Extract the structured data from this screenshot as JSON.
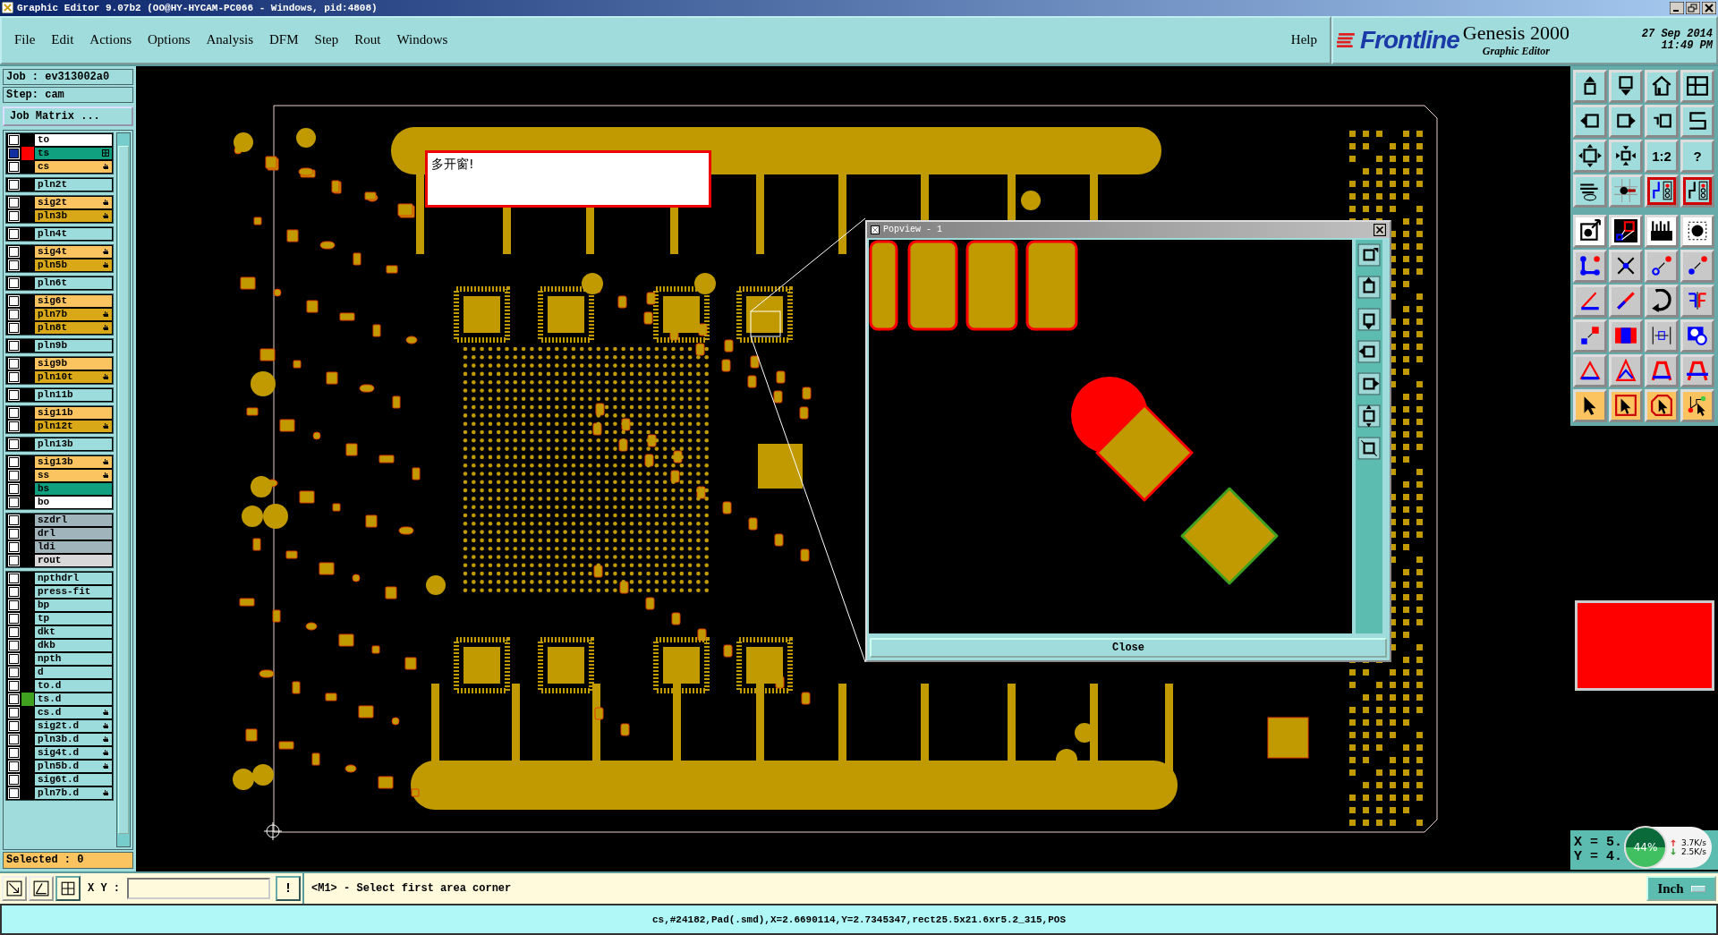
{
  "window": {
    "title": "Graphic Editor 9.07b2 (OO@HY-HYCAM-PC066 - Windows, pid:4808)"
  },
  "menu": [
    "File",
    "Edit",
    "Actions",
    "Options",
    "Analysis",
    "DFM",
    "Step",
    "Rout",
    "Windows"
  ],
  "help": "Help",
  "brand": {
    "logo": "Frontline",
    "product": "Genesis 2000",
    "subtitle": "Graphic Editor",
    "date": "27 Sep 2014",
    "time": "11:49 PM"
  },
  "job": {
    "job": "Job : ev313002a0",
    "step": "Step: cam",
    "matrix_button": "Job Matrix ..."
  },
  "layer_groups": [
    {
      "layers": [
        {
          "name": "to",
          "color": "#ffffff",
          "selected": false,
          "affected": false
        },
        {
          "name": "ts",
          "color": "#10a080",
          "selected": true,
          "affected": false,
          "work": true,
          "swatch": {
            "color": "#ff0000"
          }
        },
        {
          "name": "cs",
          "color": "#fcc460",
          "selected": false,
          "affected": true
        }
      ]
    },
    {
      "layers": [
        {
          "name": "pln2t",
          "color": "#9ddcdc",
          "selected": false,
          "affected": false
        }
      ]
    },
    {
      "layers": [
        {
          "name": "sig2t",
          "color": "#fcc460",
          "selected": false,
          "affected": true
        },
        {
          "name": "pln3b",
          "color": "#d8a818",
          "selected": false,
          "affected": true
        }
      ]
    },
    {
      "layers": [
        {
          "name": "pln4t",
          "color": "#9ddcdc",
          "selected": false,
          "affected": false
        }
      ]
    },
    {
      "layers": [
        {
          "name": "sig4t",
          "color": "#fcc460",
          "selected": false,
          "affected": true
        },
        {
          "name": "pln5b",
          "color": "#d8a818",
          "selected": false,
          "affected": true
        }
      ]
    },
    {
      "layers": [
        {
          "name": "pln6t",
          "color": "#9ddcdc",
          "selected": false,
          "affected": false
        }
      ]
    },
    {
      "layers": [
        {
          "name": "sig6t",
          "color": "#fcc460",
          "selected": false,
          "affected": false
        },
        {
          "name": "pln7b",
          "color": "#d8a818",
          "selected": false,
          "affected": true
        },
        {
          "name": "pln8t",
          "color": "#d8a818",
          "selected": false,
          "affected": true
        }
      ]
    },
    {
      "layers": [
        {
          "name": "pln9b",
          "color": "#9ddcdc",
          "selected": false,
          "affected": false
        }
      ]
    },
    {
      "layers": [
        {
          "name": "sig9b",
          "color": "#fcc460",
          "selected": false,
          "affected": false
        },
        {
          "name": "pln10t",
          "color": "#d8a818",
          "selected": false,
          "affected": true
        }
      ]
    },
    {
      "layers": [
        {
          "name": "pln11b",
          "color": "#9ddcdc",
          "selected": false,
          "affected": false
        }
      ]
    },
    {
      "layers": [
        {
          "name": "sig11b",
          "color": "#fcc460",
          "selected": false,
          "affected": false
        },
        {
          "name": "pln12t",
          "color": "#d8a818",
          "selected": false,
          "affected": true
        }
      ]
    },
    {
      "layers": [
        {
          "name": "pln13b",
          "color": "#9ddcdc",
          "selected": false,
          "affected": false
        }
      ]
    },
    {
      "layers": [
        {
          "name": "sig13b",
          "color": "#fcc460",
          "selected": false,
          "affected": true
        },
        {
          "name": "ss",
          "color": "#fcc460",
          "selected": false,
          "affected": true
        },
        {
          "name": "bs",
          "color": "#10a080",
          "selected": false,
          "affected": false
        },
        {
          "name": "bo",
          "color": "#ffffff",
          "selected": false,
          "affected": false
        }
      ]
    },
    {
      "layers": [
        {
          "name": "szdrl",
          "color": "#a0b4bc",
          "selected": false,
          "affected": false
        },
        {
          "name": "drl",
          "color": "#a0b4bc",
          "selected": false,
          "affected": false
        },
        {
          "name": "ldi",
          "color": "#a0b4bc",
          "selected": false,
          "affected": false
        },
        {
          "name": "rout",
          "color": "#d8d8d8",
          "selected": false,
          "affected": false
        }
      ]
    },
    {
      "layers": [
        {
          "name": "npthdrl",
          "color": "#9ddcdc",
          "selected": false,
          "affected": false
        },
        {
          "name": "press-fit",
          "color": "#9ddcdc",
          "selected": false,
          "affected": false
        },
        {
          "name": "bp",
          "color": "#9ddcdc",
          "selected": false,
          "affected": false
        },
        {
          "name": "tp",
          "color": "#9ddcdc",
          "selected": false,
          "affected": false
        },
        {
          "name": "dkt",
          "color": "#9ddcdc",
          "selected": false,
          "affected": false
        },
        {
          "name": "dkb",
          "color": "#9ddcdc",
          "selected": false,
          "affected": false
        },
        {
          "name": "npth",
          "color": "#9ddcdc",
          "selected": false,
          "affected": false
        },
        {
          "name": "d",
          "color": "#9ddcdc",
          "selected": false,
          "affected": false
        },
        {
          "name": "to.d",
          "color": "#9ddcdc",
          "selected": false,
          "affected": false
        },
        {
          "name": "ts.d",
          "color": "#9ddcdc",
          "selected": false,
          "affected": false,
          "swatch": {
            "color": "#40a020"
          }
        },
        {
          "name": "cs.d",
          "color": "#9ddcdc",
          "selected": false,
          "affected": true
        },
        {
          "name": "sig2t.d",
          "color": "#9ddcdc",
          "selected": false,
          "affected": true
        },
        {
          "name": "pln3b.d",
          "color": "#9ddcdc",
          "selected": false,
          "affected": true
        },
        {
          "name": "sig4t.d",
          "color": "#9ddcdc",
          "selected": false,
          "affected": true
        },
        {
          "name": "pln5b.d",
          "color": "#9ddcdc",
          "selected": false,
          "affected": true
        },
        {
          "name": "sig6t.d",
          "color": "#9ddcdc",
          "selected": false,
          "affected": false
        },
        {
          "name": "pln7b.d",
          "color": "#9ddcdc",
          "selected": false,
          "affected": true
        }
      ]
    }
  ],
  "selected_count": "Selected : 0",
  "note": "多开窗!",
  "popview": {
    "title": "Popview - 1",
    "close": "Close"
  },
  "toolbar": [
    {
      "kind": "view",
      "tools": [
        {
          "on": false
        },
        {
          "on": false
        },
        {
          "on": false
        },
        {
          "on": false
        }
      ]
    },
    {
      "kind": "view",
      "tools": [
        {
          "on": false
        },
        {
          "on": false
        },
        {
          "on": false
        },
        {
          "on": false
        }
      ]
    },
    {
      "kind": "view",
      "tools": [
        {
          "on": false
        },
        {
          "on": false
        },
        {
          "label": "1:2",
          "on": false
        },
        {
          "label": "?",
          "on": false
        }
      ]
    },
    {
      "kind": "view",
      "tools": [
        {
          "on": false
        },
        {
          "on": false
        },
        {
          "on": true
        },
        {
          "on": true
        }
      ]
    },
    {
      "kind": "measure",
      "tools": [
        {
          "on": false
        },
        {
          "on": false
        },
        {
          "on": false
        },
        {
          "on": false
        }
      ]
    },
    {
      "kind": "edit",
      "tools": [
        {
          "on": false
        },
        {
          "on": false
        },
        {
          "on": false
        },
        {
          "on": false
        }
      ]
    },
    {
      "kind": "edit",
      "tools": [
        {
          "on": false
        },
        {
          "on": false
        },
        {
          "on": false
        },
        {
          "on": false
        }
      ]
    },
    {
      "kind": "edit",
      "tools": [
        {
          "on": false
        },
        {
          "on": false
        },
        {
          "on": false
        },
        {
          "on": false
        }
      ]
    },
    {
      "kind": "edit",
      "tools": [
        {
          "on": false
        },
        {
          "on": false
        },
        {
          "on": false
        },
        {
          "on": false
        }
      ]
    },
    {
      "kind": "select",
      "tools": [
        {
          "on": false
        },
        {
          "on": false
        },
        {
          "on": false
        },
        {
          "on": false
        }
      ]
    }
  ],
  "coords": {
    "x": "X = 5.",
    "y": "Y = 4."
  },
  "net_meter": {
    "percent": "44%",
    "up": "3.7K/s",
    "down": "2.5K/s"
  },
  "command": {
    "xy_label": "X Y :",
    "alert": "!",
    "prompt": "<M1> - Select first area corner",
    "units": "Inch"
  },
  "status": "cs,#24182,Pad(.smd),X=2.6690114,Y=2.7345347,rect25.5x21.6xr5.2_315,POS"
}
